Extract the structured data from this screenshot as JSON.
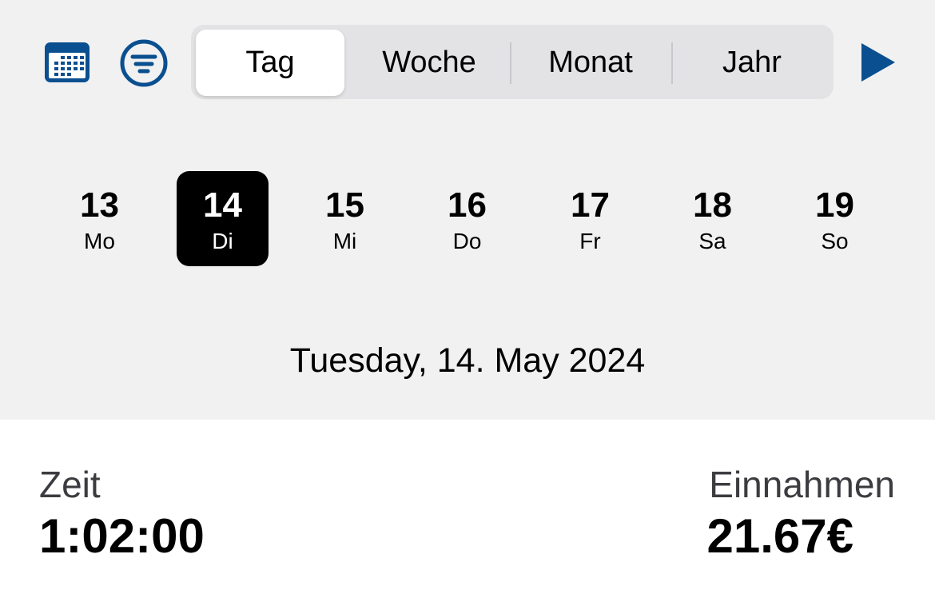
{
  "colors": {
    "accent": "#0a4f8f",
    "background": "#f1f1f1",
    "selected_day_bg": "#000000"
  },
  "toolbar": {
    "calendar_icon": "calendar-icon",
    "filter_icon": "filter-icon",
    "next_icon": "play-icon",
    "segments": [
      {
        "label": "Tag",
        "active": true
      },
      {
        "label": "Woche",
        "active": false
      },
      {
        "label": "Monat",
        "active": false
      },
      {
        "label": "Jahr",
        "active": false
      }
    ]
  },
  "week": {
    "days": [
      {
        "num": "13",
        "name": "Mo"
      },
      {
        "num": "14",
        "name": "Di",
        "selected": true
      },
      {
        "num": "15",
        "name": "Mi"
      },
      {
        "num": "16",
        "name": "Do"
      },
      {
        "num": "17",
        "name": "Fr"
      },
      {
        "num": "18",
        "name": "Sa"
      },
      {
        "num": "19",
        "name": "So"
      }
    ]
  },
  "selected_date": "Tuesday, 14. May 2024",
  "stats": {
    "time_label": "Zeit",
    "time_value": "1:02:00",
    "income_label": "Einnahmen",
    "income_value": "21.67€"
  }
}
